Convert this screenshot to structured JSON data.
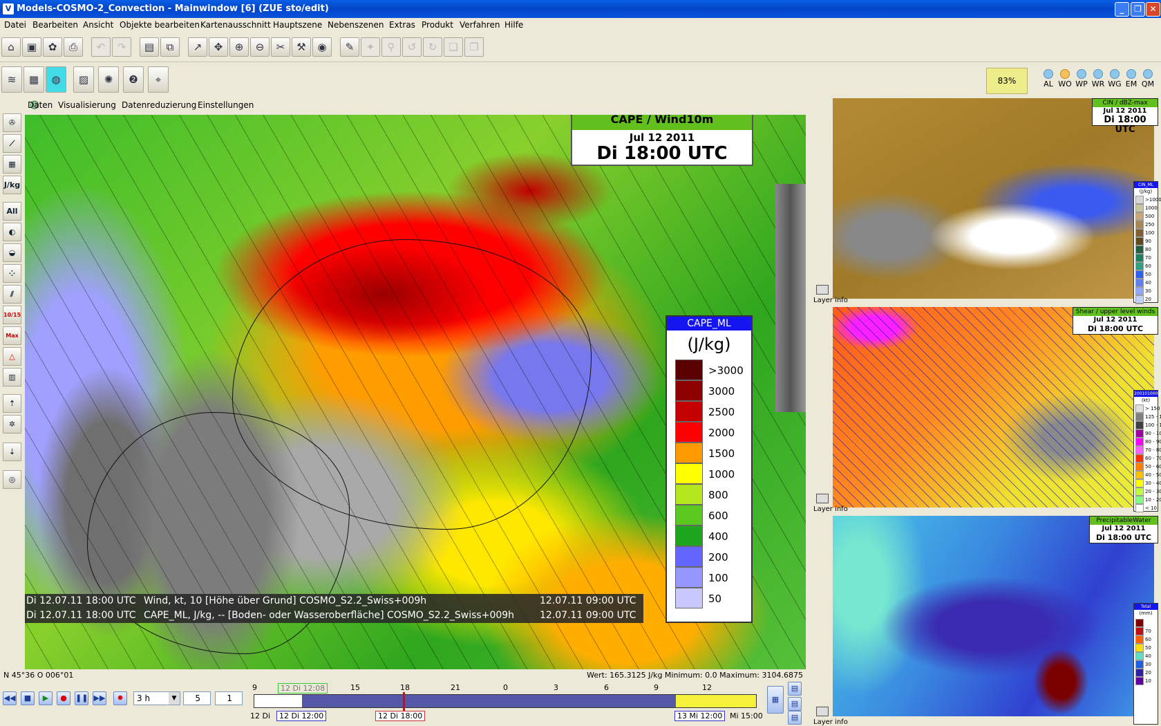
{
  "window": {
    "title": "Models-COSMO-2_Convection - Mainwindow [6] (ZUE sto/edit)",
    "minimize": "_",
    "maximize": "❐",
    "close": "✕"
  },
  "menubar": [
    "Datei",
    "Bearbeiten",
    "Ansicht",
    "Objekte bearbeiten",
    "Kartenausschnitt",
    "Hauptszene",
    "Nebenszenen",
    "Extras",
    "Produkt",
    "Verfahren",
    "Hilfe"
  ],
  "toolbar": {
    "zoom": "83%",
    "regions": [
      "AL",
      "WO",
      "WP",
      "WR",
      "WG",
      "EM",
      "QM"
    ],
    "active_region": "WO"
  },
  "left_tools": [
    "J/kg",
    "All",
    "10/15",
    "Max Min"
  ],
  "submenu": [
    "Daten",
    "Visualisierung",
    "Datenreduzierung",
    "Einstellungen"
  ],
  "main_map": {
    "title": "CAPE / Wind10m",
    "date": "Jul 12 2011",
    "time": "Di 18:00 UTC",
    "legend_title": "CAPE_ML",
    "legend_unit": "(J/kg)",
    "legend": [
      {
        "label": ">3000",
        "color": "#5a0000"
      },
      {
        "label": "3000",
        "color": "#8c0000"
      },
      {
        "label": "2500",
        "color": "#c40000"
      },
      {
        "label": "2000",
        "color": "#ff0000"
      },
      {
        "label": "1500",
        "color": "#ff9900"
      },
      {
        "label": "1000",
        "color": "#ffff00"
      },
      {
        "label": "800",
        "color": "#b4e61e"
      },
      {
        "label": "600",
        "color": "#5ac81e"
      },
      {
        "label": "400",
        "color": "#1ea51e"
      },
      {
        "label": "200",
        "color": "#6464ff"
      },
      {
        "label": "100",
        "color": "#9696ff"
      },
      {
        "label": "50",
        "color": "#c8c8ff"
      }
    ],
    "info_lines": [
      {
        "valid": "Di 12.07.11 18:00 UTC",
        "desc": "Wind, kt, 10 [Höhe über Grund] COSMO_S2.2_Swiss+009h",
        "run": "12.07.11 09:00 UTC"
      },
      {
        "valid": "Di 12.07.11 18:00 UTC",
        "desc": "CAPE_ML, J/kg, -- [Boden- oder Wasseroberfläche] COSMO_S2.2_Swiss+009h",
        "run": "12.07.11 09:00 UTC"
      }
    ]
  },
  "status": {
    "coords": "N 45°36 O 006°01",
    "values": "Wert: 165.3125 J/kg  Minimum: 0.0  Maximum: 3104.6875"
  },
  "timeline": {
    "step": "3 h",
    "spin1": "5",
    "spin2": "1",
    "hours": [
      "9",
      "12 Di 12:08",
      "15",
      "18",
      "21",
      "0",
      "3",
      "6",
      "9",
      "12"
    ],
    "start_label": "12 Di",
    "range_start": "12 Di 12:00",
    "current": "12 Di 18:00",
    "range_end": "13 Mi 12:00",
    "end_label": "Mi 15:00"
  },
  "side_panels": [
    {
      "title": "CIN / dBZ-max",
      "date": "Jul 12 2011",
      "time": "Di 18:00 UTC",
      "legend_title": "CIN_ML",
      "legend_unit": "(J/kg)",
      "legend": [
        {
          "label": ">1000",
          "color": "#d8d8d8"
        },
        {
          "label": "1000",
          "color": "#c8c8a0"
        },
        {
          "label": "500",
          "color": "#c8a878"
        },
        {
          "label": "250",
          "color": "#a88850"
        },
        {
          "label": "100",
          "color": "#806030"
        },
        {
          "label": "90",
          "color": "#604820"
        },
        {
          "label": "80",
          "color": "#206040"
        },
        {
          "label": "70",
          "color": "#208060"
        },
        {
          "label": "60",
          "color": "#30a080"
        },
        {
          "label": "50",
          "color": "#3060f0"
        },
        {
          "label": "40",
          "color": "#6080f0"
        },
        {
          "label": "30",
          "color": "#90a8f8"
        },
        {
          "label": "20",
          "color": "#c0d0fc"
        },
        {
          "label": "10",
          "color": "#ffffff"
        }
      ],
      "layer_info": "Layer info"
    },
    {
      "title": "Shear / upper level winds",
      "date": "Jul 12 2011",
      "time": "Di 18:00 UTC",
      "legend_title": "200101000006",
      "legend_unit": "(kt)",
      "legend": [
        {
          "label": "> 150",
          "color": "#e0e0e0"
        },
        {
          "label": "125 - 150",
          "color": "#808080"
        },
        {
          "label": "100 - 125",
          "color": "#404040"
        },
        {
          "label": "90 - 100",
          "color": "#a000a0"
        },
        {
          "label": "80 - 90",
          "color": "#ff00ff"
        },
        {
          "label": "70 - 80",
          "color": "#ff60ff"
        },
        {
          "label": "60 - 70",
          "color": "#ff3000"
        },
        {
          "label": "50 - 60",
          "color": "#ff8000"
        },
        {
          "label": "40 - 50",
          "color": "#ffc000"
        },
        {
          "label": "30 - 40",
          "color": "#ffff00"
        },
        {
          "label": "20 - 30",
          "color": "#c0ff40"
        },
        {
          "label": "10 - 20",
          "color": "#80ff80"
        },
        {
          "label": "< 10",
          "color": "#ffffff"
        }
      ],
      "layer_info": "Layer info"
    },
    {
      "title": "PrecipitableWater",
      "date": "Jul 12 2011",
      "time": "Di 18:00 UTC",
      "legend_title": "Total column water",
      "legend_unit": "(mm)",
      "legend": [
        {
          "label": "",
          "color": "#800000"
        },
        {
          "label": "70",
          "color": "#c01010"
        },
        {
          "label": "60",
          "color": "#ff6000"
        },
        {
          "label": "50",
          "color": "#ffe000"
        },
        {
          "label": "40",
          "color": "#60e0c0"
        },
        {
          "label": "30",
          "color": "#2060e0"
        },
        {
          "label": "20",
          "color": "#3020a0"
        },
        {
          "label": "10",
          "color": "#6000a0"
        }
      ],
      "layer_info": "Layer info"
    }
  ]
}
